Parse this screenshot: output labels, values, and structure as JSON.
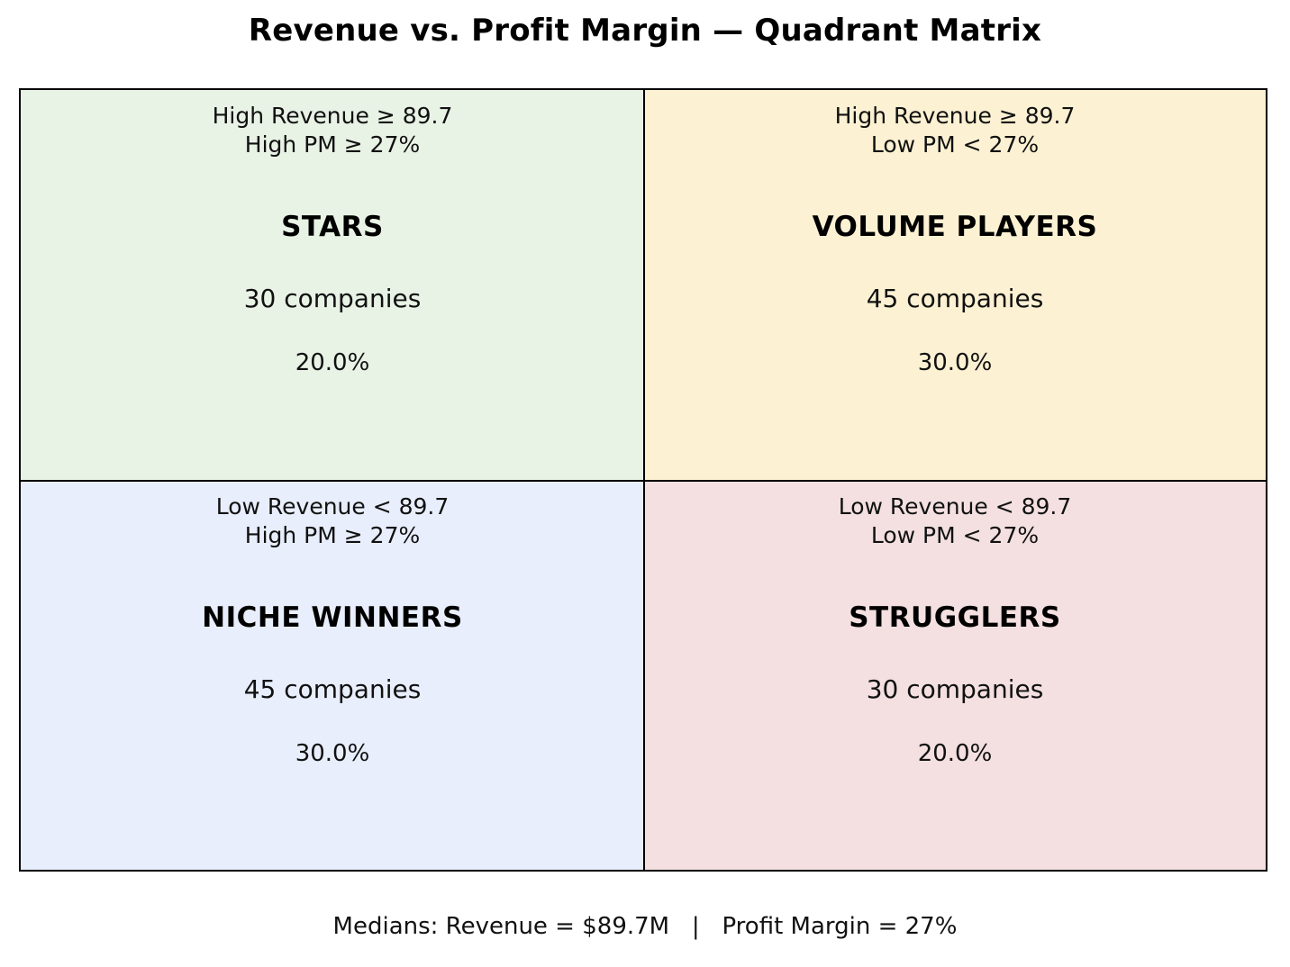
{
  "title": "Revenue vs. Profit Margin — Quadrant Matrix",
  "quadrants": [
    {
      "id": "stars",
      "condition_revenue": "High Revenue ≥ 89.7",
      "condition_pm": "High PM ≥ 27%",
      "name": "STARS",
      "count": "30 companies",
      "percent": "20.0%",
      "color": "#e8f2e5"
    },
    {
      "id": "volume-players",
      "condition_revenue": "High Revenue ≥ 89.7",
      "condition_pm": "Low PM < 27%",
      "name": "VOLUME PLAYERS",
      "count": "45 companies",
      "percent": "30.0%",
      "color": "#fcf1d2"
    },
    {
      "id": "niche-winners",
      "condition_revenue": "Low Revenue < 89.7",
      "condition_pm": "High PM ≥ 27%",
      "name": "NICHE WINNERS",
      "count": "45 companies",
      "percent": "30.0%",
      "color": "#e8eefb"
    },
    {
      "id": "strugglers",
      "condition_revenue": "Low Revenue < 89.7",
      "condition_pm": "Low PM < 27%",
      "name": "STRUGGLERS",
      "count": "30 companies",
      "percent": "20.0%",
      "color": "#f4e0e0"
    }
  ],
  "footer": "Medians: Revenue = $89.7M   |   Profit Margin = 27%"
}
